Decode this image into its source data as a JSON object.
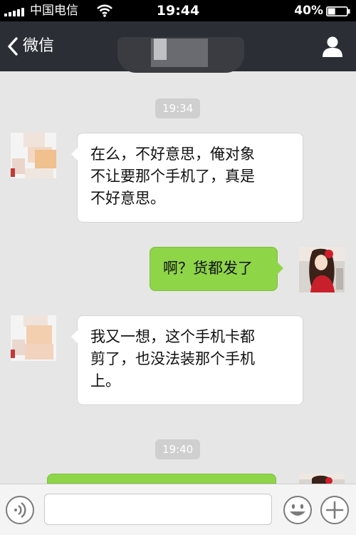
{
  "status_bar": {
    "carrier": "中国电信",
    "time": "19:44",
    "battery": "40%",
    "battery_level": 0.4,
    "icons": [
      "signal-bars-icon",
      "wifi-icon",
      "battery-icon"
    ]
  },
  "nav": {
    "back_label": "微信",
    "title": "",
    "icons": [
      "back-chevron-icon",
      "contact-person-icon"
    ]
  },
  "messages": [
    {
      "type": "time",
      "text": "19:34"
    },
    {
      "type": "incoming",
      "text": "在么，不好意思，俺对象\n不让要那个手机了，真是\n不好意思。"
    },
    {
      "type": "outgoing",
      "text": "啊？货都发了"
    },
    {
      "type": "incoming",
      "text": "我又一想，这个手机卡都\n剪了，也没法装那个手机\n上。"
    },
    {
      "type": "time",
      "text": "19:40"
    },
    {
      "type": "outgoing",
      "text": ""
    }
  ],
  "input_bar": {
    "placeholder": "",
    "value": "",
    "icons": [
      "voice-icon",
      "emoji-icon",
      "plus-icon"
    ]
  },
  "colors": {
    "nav_background": "#2b2e35",
    "chat_background": "#e6e6e6",
    "outgoing_bubble": "#8ed548",
    "incoming_bubble": "#ffffff",
    "time_pill": "#cfcfcf"
  }
}
